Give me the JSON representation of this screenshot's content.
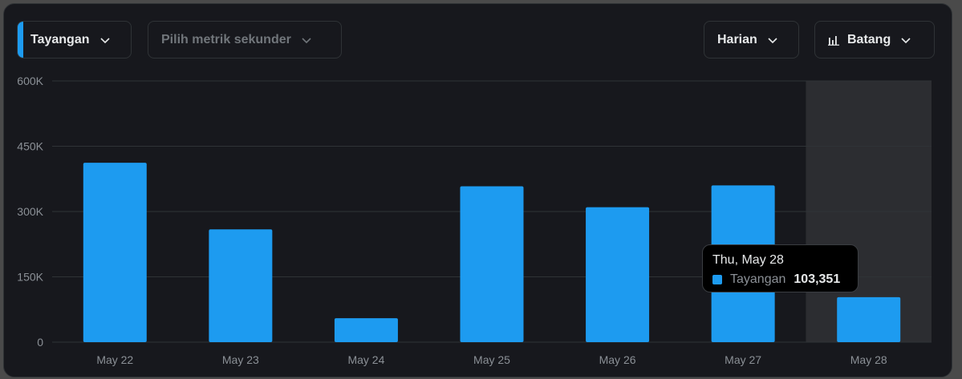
{
  "controls": {
    "primary_metric": "Tayangan",
    "secondary_metric_placeholder": "Pilih metrik sekunder",
    "period": "Harian",
    "chart_type": "Batang"
  },
  "colors": {
    "bar": "#1d9bf0",
    "highlight": "#2c2d31",
    "grid": "#2f3336",
    "tick_text": "#8b9096"
  },
  "tooltip": {
    "date": "Thu, May 28",
    "series": "Tayangan",
    "value": "103,351"
  },
  "chart_data": {
    "type": "bar",
    "categories": [
      "May 22",
      "May 23",
      "May 24",
      "May 25",
      "May 26",
      "May 27",
      "May 28"
    ],
    "series": [
      {
        "name": "Tayangan",
        "values": [
          412000,
          259000,
          55000,
          358000,
          310000,
          360000,
          103351
        ]
      }
    ],
    "ylim": [
      0,
      600000
    ],
    "yticks": [
      0,
      150000,
      300000,
      450000,
      600000
    ],
    "ytick_labels": [
      "0",
      "150K",
      "300K",
      "450K",
      "600K"
    ],
    "grid": true,
    "highlighted_category": "May 28"
  }
}
